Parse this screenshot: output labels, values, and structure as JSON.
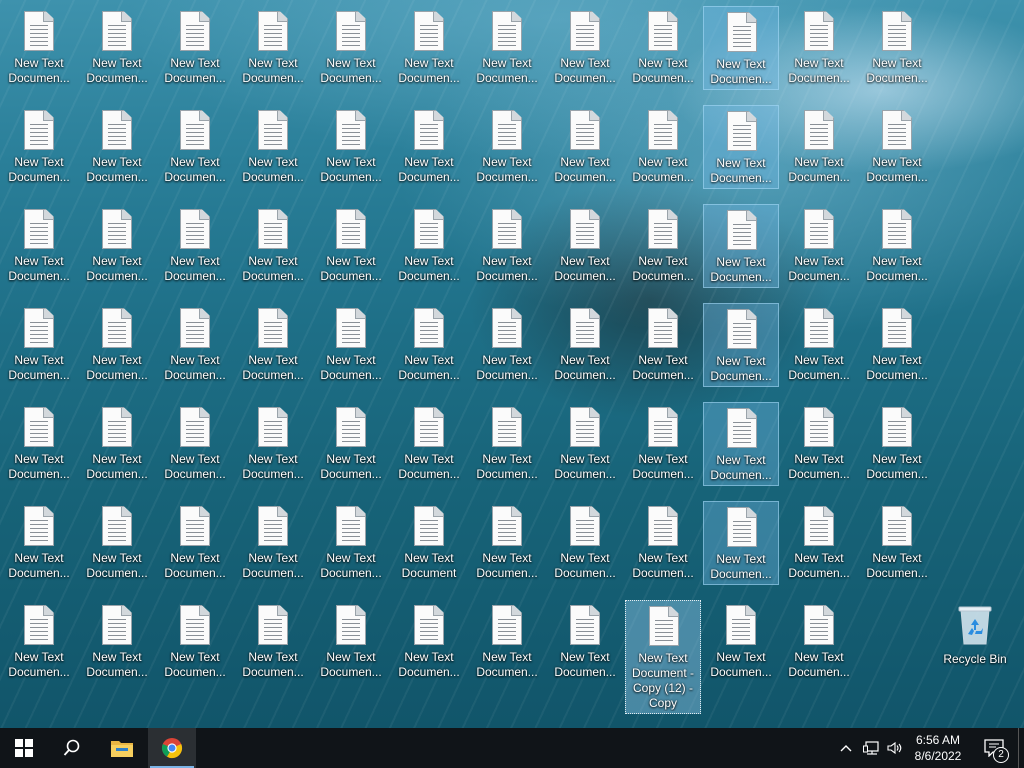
{
  "desktop": {
    "default_label": [
      "New Text",
      "Documen..."
    ],
    "special_labels": {
      "5-5": [
        "New Text",
        "Document"
      ],
      "6-8": [
        "New Text",
        "Document -",
        "Copy (12) -",
        "Copy"
      ]
    },
    "rows": 7,
    "columns": 12,
    "selected_column": 9,
    "focused_cell": "6-8",
    "last_row_columns": 11,
    "recycle_bin_label": "Recycle Bin"
  },
  "taskbar": {
    "start_icon": "windows-logo-icon",
    "search_icon": "search-icon",
    "explorer_icon": "file-explorer-icon",
    "chrome_icon": "chrome-icon",
    "tray": {
      "chevron_icon": "chevron-up-icon",
      "network_icon": "network-icon",
      "volume_icon": "volume-icon",
      "time": "6:56 AM",
      "date": "8/6/2022",
      "notification_count": "2"
    }
  },
  "colors": {
    "taskbar": "#101418",
    "selection": "#78bee8",
    "accent": "#7ab3e6"
  }
}
